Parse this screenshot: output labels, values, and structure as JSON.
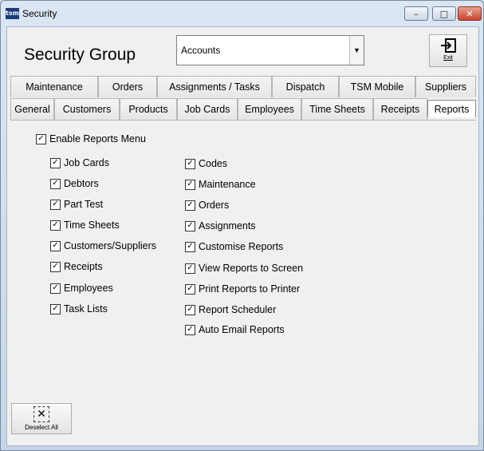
{
  "window": {
    "app_icon_text": "tsm",
    "title": "Security",
    "buttons": {
      "minimize": "–",
      "maximize": "□",
      "close": "✕"
    }
  },
  "header": {
    "title": "Security Group",
    "group_select": {
      "value": "Accounts",
      "arrow": "▼"
    },
    "exit_label": "Exit"
  },
  "tabs": {
    "row1": [
      "Maintenance",
      "Orders",
      "Assignments / Tasks",
      "Dispatch",
      "TSM Mobile",
      "Suppliers"
    ],
    "row2": [
      "General",
      "Customers",
      "Products",
      "Job Cards",
      "Employees",
      "Time Sheets",
      "Receipts",
      "Reports"
    ],
    "active": "Reports"
  },
  "reports": {
    "enable_menu": {
      "label": "Enable Reports Menu",
      "checked": true
    },
    "left": [
      {
        "label": "Job Cards",
        "checked": true
      },
      {
        "label": "Debtors",
        "checked": true
      },
      {
        "label": "Part Test",
        "checked": true
      },
      {
        "label": "Time Sheets",
        "checked": true
      },
      {
        "label": "Customers/Suppliers",
        "checked": true
      },
      {
        "label": "Receipts",
        "checked": true
      },
      {
        "label": "Employees",
        "checked": true
      },
      {
        "label": "Task Lists",
        "checked": true
      }
    ],
    "right": [
      {
        "label": "Codes",
        "checked": true
      },
      {
        "label": "Maintenance",
        "checked": true
      },
      {
        "label": "Orders",
        "checked": true
      },
      {
        "label": "Assignments",
        "checked": true
      },
      {
        "label": "Customise Reports",
        "checked": true
      },
      {
        "label": "View Reports to Screen",
        "checked": true
      },
      {
        "label": "Print Reports to Printer",
        "checked": true
      },
      {
        "label": "Report Scheduler",
        "checked": true
      },
      {
        "label": "Auto Email Reports",
        "checked": true
      }
    ],
    "check_glyph": "✓"
  },
  "footer": {
    "deselect_label": "Deselect All",
    "deselect_icon": "✕"
  }
}
